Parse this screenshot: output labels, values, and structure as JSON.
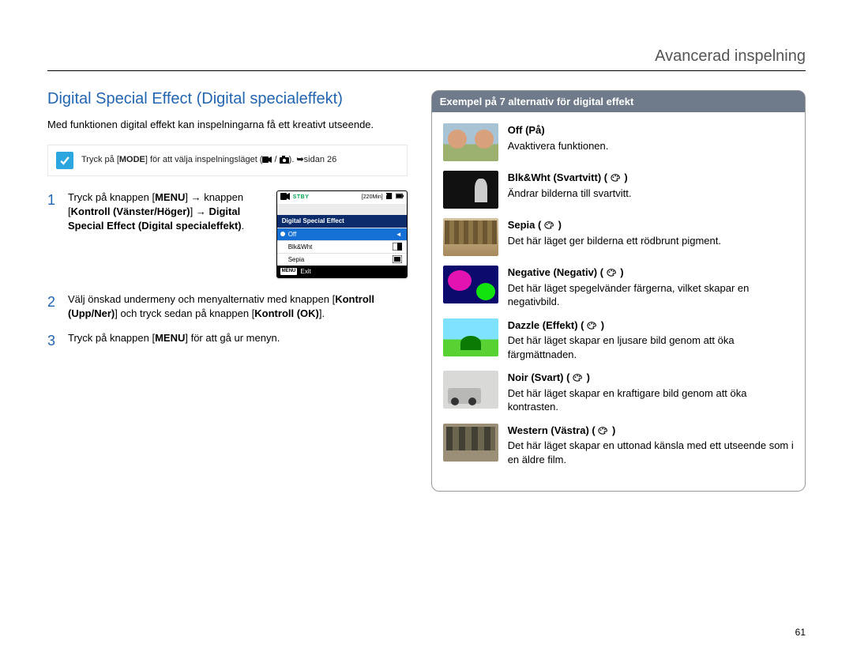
{
  "header": {
    "title": "Avancerad inspelning"
  },
  "page_number": "61",
  "section": {
    "title": "Digital Special Effect (Digital specialeffekt)",
    "intro": "Med funktionen digital effekt kan inspelningarna få ett kreativt utseende.",
    "note_prefix": "Tryck på [",
    "note_mode": "MODE",
    "note_mid": "] för att välja inspelningsläget (",
    "note_suffix": ").  ",
    "note_arrow": "➥",
    "note_page": "sidan 26"
  },
  "lcd": {
    "stby": "STBY",
    "time": "[220Min]",
    "menu_label": "Digital Special Effect",
    "items": [
      "Off",
      "Blk&Wht",
      "Sepia"
    ],
    "exit_chip": "MENU",
    "exit": "Exit"
  },
  "steps": [
    {
      "num": "1",
      "parts": {
        "a": "Tryck på knappen [",
        "b": "MENU",
        "c": "] ",
        "arr": "→",
        "d": " knappen [",
        "e": "Kontroll (Vänster/Höger)",
        "f": "] ",
        "arr2": "→",
        "g": " ",
        "h": "Digital Special Effect (Digital specialeffekt)",
        "i": "."
      }
    },
    {
      "num": "2",
      "parts": {
        "a": "Välj önskad undermeny och menyalternativ med knappen [",
        "b": "Kontroll (Upp/Ner)",
        "c": "] och tryck sedan på knappen [",
        "d": "Kontroll (OK)",
        "e": "]."
      }
    },
    {
      "num": "3",
      "parts": {
        "a": "Tryck på knappen [",
        "b": "MENU",
        "c": "] för att gå ur menyn."
      }
    }
  ],
  "panel": {
    "title": "Exempel på 7 alternativ för digital effekt",
    "effects": [
      {
        "key": "off",
        "name": "Off (På)",
        "glyph": "",
        "desc": "Avaktivera funktionen."
      },
      {
        "key": "bw",
        "name": "Blk&Wht (Svartvitt)",
        "glyph": "bw",
        "desc": "Ändrar bilderna till svartvitt."
      },
      {
        "key": "sepia",
        "name": "Sepia",
        "glyph": "sp",
        "desc": "Det här läget ger bilderna ett rödbrunt pigment."
      },
      {
        "key": "neg",
        "name": "Negative (Negativ)",
        "glyph": "ng",
        "desc": "Det här läget spegelvänder färgerna, vilket skapar en negativbild."
      },
      {
        "key": "dazzle",
        "name": "Dazzle (Effekt)",
        "glyph": "dz",
        "desc": "Det här läget skapar en ljusare bild genom att öka färgmättnaden."
      },
      {
        "key": "noir",
        "name": "Noir (Svart)",
        "glyph": "nr",
        "desc": "Det här läget skapar en kraftigare bild genom att öka kontrasten."
      },
      {
        "key": "western",
        "name": "Western (Västra)",
        "glyph": "ws",
        "desc": "Det här läget skapar en uttonad känsla med ett utseende som i en äldre film."
      }
    ]
  }
}
